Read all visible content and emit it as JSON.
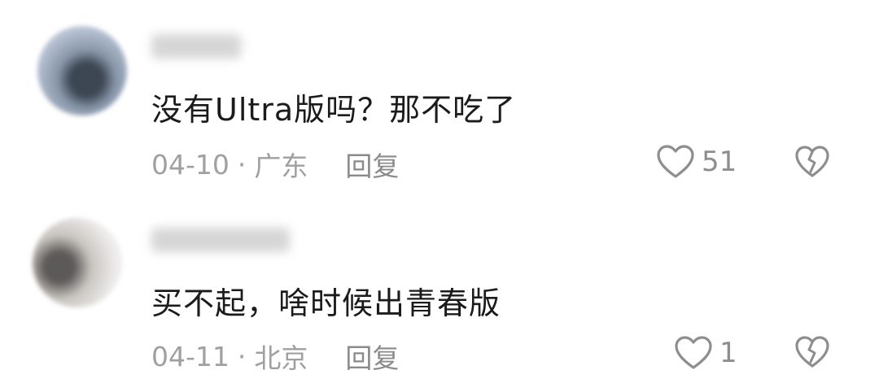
{
  "comments": [
    {
      "text": "没有Ultra版吗？那不吃了",
      "date": "04-10",
      "dot": "·",
      "location": "广东",
      "reply_label": "回复",
      "likes": "51"
    },
    {
      "text": "买不起，啥时候出青春版",
      "date": "04-11",
      "dot": "·",
      "location": "北京",
      "reply_label": "回复",
      "likes": "1"
    }
  ],
  "icons": {
    "like": "heart-outline-icon",
    "dislike": "broken-heart-icon"
  },
  "colors": {
    "text": "#1b1b1b",
    "meta": "#a0a0a0",
    "icon": "#8e8e8e"
  }
}
